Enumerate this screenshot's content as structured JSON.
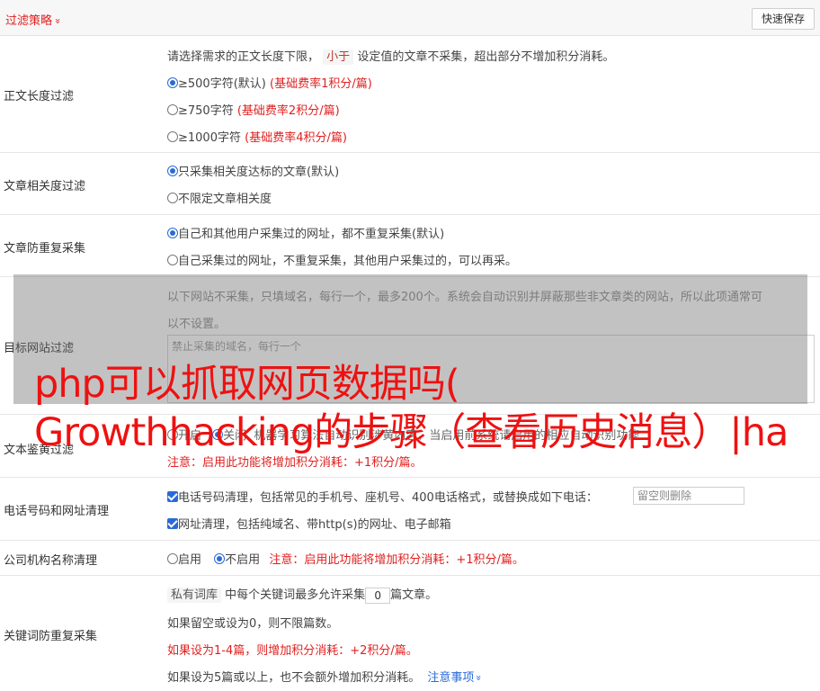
{
  "header": {
    "title": "过滤策略",
    "chevron": "»",
    "save_label": "快速保存"
  },
  "content_length": {
    "label": "正文长度过滤",
    "intro_pre": "请选择需求的正文长度下限，",
    "intro_tag": "小于",
    "intro_post": "设定值的文章不采集，超出部分不增加积分消耗。",
    "options": [
      {
        "label": "≥500字符(默认)",
        "rate": "(基础费率1积分/篇)",
        "selected": true
      },
      {
        "label": "≥750字符",
        "rate": "(基础费率2积分/篇)",
        "selected": false
      },
      {
        "label": "≥1000字符",
        "rate": "(基础费率4积分/篇)",
        "selected": false
      }
    ]
  },
  "relevance": {
    "label": "文章相关度过滤",
    "options": [
      {
        "label": "只采集相关度达标的文章(默认)",
        "selected": true
      },
      {
        "label": "不限定文章相关度",
        "selected": false
      }
    ]
  },
  "dedupe": {
    "label": "文章防重复采集",
    "options": [
      {
        "label": "自己和其他用户采集过的网址，都不重复采集(默认)",
        "selected": true
      },
      {
        "label": "自己采集过的网址，不重复采集，其他用户采集过的，可以再采。",
        "selected": false
      }
    ]
  },
  "target_site": {
    "label": "目标网站过滤",
    "desc_line1": "以下网站不采集，只填域名，每行一个，最多200个。系统会自动识别并屏蔽那些非文章类的网站，所以此项通常可",
    "desc_line2": "以不设置。",
    "placeholder": "禁止采集的域名，每行一个"
  },
  "porn": {
    "label": "文本鉴黄过滤",
    "opt_on": "开启",
    "opt_off": "关闭",
    "desc": "机器学习算法自动识别涉黄内容，当启用前系统请启用的相应自动识别功能",
    "note": "注意：启用此功能将增加积分消耗：+1积分/篇。"
  },
  "phone_url": {
    "label": "电话号码和网址清理",
    "phone_text": "电话号码清理，包括常见的手机号、座机号、400电话格式，或替换成如下电话：",
    "phone_placeholder": "留空则删除",
    "url_text": "网址清理，包括纯域名、带http(s)的网址、电子邮箱"
  },
  "org": {
    "label": "公司机构名称清理",
    "opt_on": "启用",
    "opt_off": "不启用",
    "note": "注意：启用此功能将增加积分消耗：+1积分/篇。"
  },
  "keyword": {
    "label": "关键词防重复采集",
    "tag": "私有词库",
    "text_pre": "中每个关键词最多允许采集",
    "value": "0",
    "text_post": "篇文章。",
    "line2": "如果留空或设为0，则不限篇数。",
    "line3": "如果设为1-4篇，则增加积分消耗：+2积分/篇。",
    "line4": "如果设为5篇或以上，也不会额外增加积分消耗。",
    "notes_link": "注意事项",
    "notes_chevron": "»"
  },
  "overlay": {
    "line1": "php可以抓取网页数据吗(",
    "line2": "Growthhacking的步骤（查看历史消息）|ha"
  }
}
